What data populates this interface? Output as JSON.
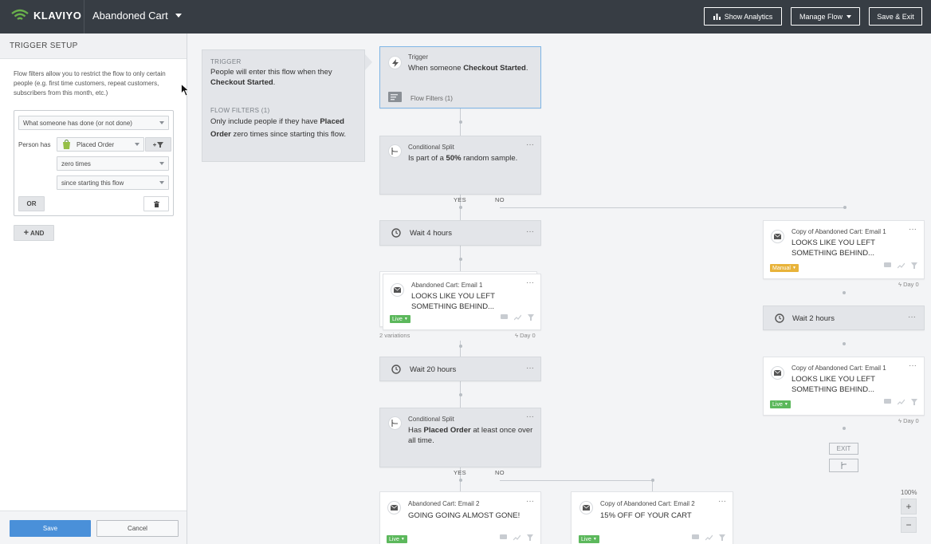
{
  "header": {
    "brand": "KLAVIYO",
    "flow_name": "Abandoned Cart",
    "buttons": {
      "analytics": "Show Analytics",
      "manage": "Manage Flow",
      "save_exit": "Save & Exit"
    }
  },
  "sidebar": {
    "title": "TRIGGER SETUP",
    "description": "Flow filters allow you to restrict the flow to only certain people (e.g. first time customers, repeat customers, subscribers from this month, etc.)",
    "filter": {
      "condition_select": "What someone has done (or not done)",
      "person_has_label": "Person has",
      "metric_select": "Placed Order",
      "frequency_select": "zero times",
      "timeframe_select": "since starting this flow",
      "or_label": "OR"
    },
    "and_label": "AND",
    "save_label": "Save",
    "cancel_label": "Cancel"
  },
  "info_panel": {
    "trigger_heading": "TRIGGER",
    "trigger_pre": "People will enter this flow when they ",
    "trigger_bold": "Checkout Started",
    "trigger_post": ".",
    "filters_heading": "FLOW FILTERS (1)",
    "filters_pre": "Only include people if they have ",
    "filters_bold": "Placed Order",
    "filters_post": " zero times since starting this flow."
  },
  "flow": {
    "trigger": {
      "label": "Trigger",
      "text_pre": "When someone ",
      "text_bold": "Checkout Started",
      "text_post": ".",
      "filters": "Flow Filters (1)"
    },
    "split1": {
      "label": "Conditional Split",
      "text_pre": "Is part of a ",
      "text_bold": "50%",
      "text_post": " random sample.",
      "yes": "YES",
      "no": "NO"
    },
    "wait1": {
      "label": "Wait 4 hours"
    },
    "email1": {
      "label": "Abandoned Cart: Email 1",
      "subject": "LOOKS LIKE YOU LEFT SOMETHING BEHIND...",
      "status": "Live",
      "variations": "2 variations",
      "day": "Day 0"
    },
    "wait2": {
      "label": "Wait 20 hours"
    },
    "split2": {
      "label": "Conditional Split",
      "text_pre": "Has ",
      "text_bold": "Placed Order",
      "text_post": " at least once over all time.",
      "yes": "YES",
      "no": "NO"
    },
    "email2": {
      "label": "Abandoned Cart: Email 2",
      "subject": "GOING GOING ALMOST GONE!",
      "status": "Live"
    },
    "email2_copy": {
      "label": "Copy of Abandoned Cart: Email 2",
      "subject": "15% OFF OF YOUR CART",
      "status": "Live"
    },
    "right_email1": {
      "label": "Copy of Abandoned Cart: Email 1",
      "subject": "LOOKS LIKE YOU LEFT SOMETHING BEHIND...",
      "status": "Manual",
      "day": "Day 0"
    },
    "right_wait": {
      "label": "Wait 2 hours"
    },
    "right_email2": {
      "label": "Copy of Abandoned Cart: Email 1",
      "subject": "LOOKS LIKE YOU LEFT SOMETHING BEHIND...",
      "status": "Live",
      "day": "Day 0"
    },
    "exit": "EXIT",
    "more": "···"
  },
  "zoom": {
    "level": "100%",
    "plus": "+",
    "minus": "−"
  }
}
